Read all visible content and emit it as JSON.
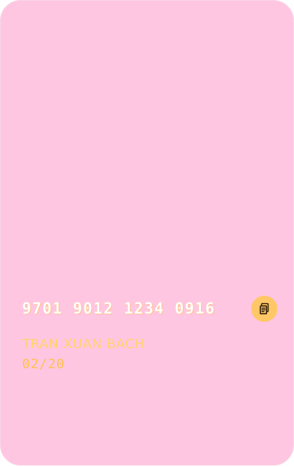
{
  "card": {
    "number": "9701 9012 1234 0916",
    "holder_name": "TRAN XUAN BACH",
    "expiry": "02/20",
    "copy_icon": "copy-icon"
  },
  "colors": {
    "card_background": "#ffc6e2",
    "number_text": "#ffffff",
    "holder_text": "#ffd36e",
    "expiry_text": "#ffc34d",
    "copy_button_background": "#ffc766",
    "copy_icon_stroke": "#2b1a0a"
  }
}
